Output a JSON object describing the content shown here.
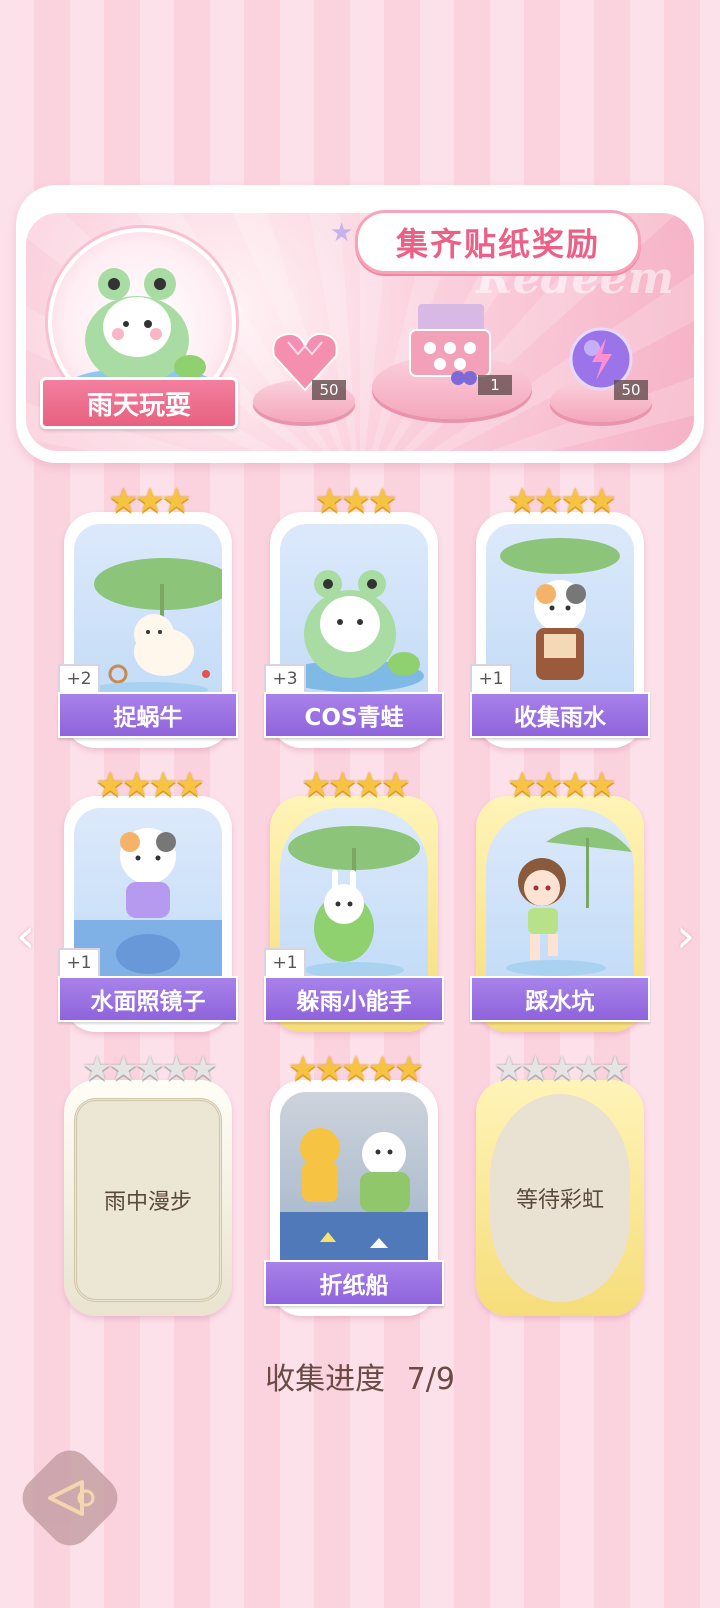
{
  "banner": {
    "title": "集齐贴纸奖励",
    "watermark": "Redeem",
    "theme_label": "雨天玩耍",
    "rewards": [
      {
        "icon": "pink-heart-gem-icon",
        "count": "50"
      },
      {
        "icon": "gift-box-icon",
        "count": "1"
      },
      {
        "icon": "purple-lightning-orb-icon",
        "count": "50"
      }
    ]
  },
  "cards": [
    {
      "name": "捉蜗牛",
      "stars": 3,
      "bonus": "+2",
      "state": "collected"
    },
    {
      "name": "COS青蛙",
      "stars": 3,
      "bonus": "+3",
      "state": "collected"
    },
    {
      "name": "收集雨水",
      "stars": 4,
      "bonus": "+1",
      "state": "collected"
    },
    {
      "name": "水面照镜子",
      "stars": 4,
      "bonus": "+1",
      "state": "collected"
    },
    {
      "name": "躲雨小能手",
      "stars": 4,
      "bonus": "+1",
      "state": "collected-gold"
    },
    {
      "name": "踩水坑",
      "stars": 4,
      "bonus": "",
      "state": "collected-gold"
    },
    {
      "name": "雨中漫步",
      "stars": 5,
      "bonus": "",
      "state": "locked"
    },
    {
      "name": "折纸船",
      "stars": 5,
      "bonus": "",
      "state": "collected"
    },
    {
      "name": "等待彩虹",
      "stars": 5,
      "bonus": "",
      "state": "locked-gold"
    }
  ],
  "progress": {
    "label": "收集进度",
    "value": "7/9"
  },
  "colors": {
    "accent": "#ec5f86",
    "name_bar": "#9b6fe3",
    "star_gold": "#f6c343"
  }
}
